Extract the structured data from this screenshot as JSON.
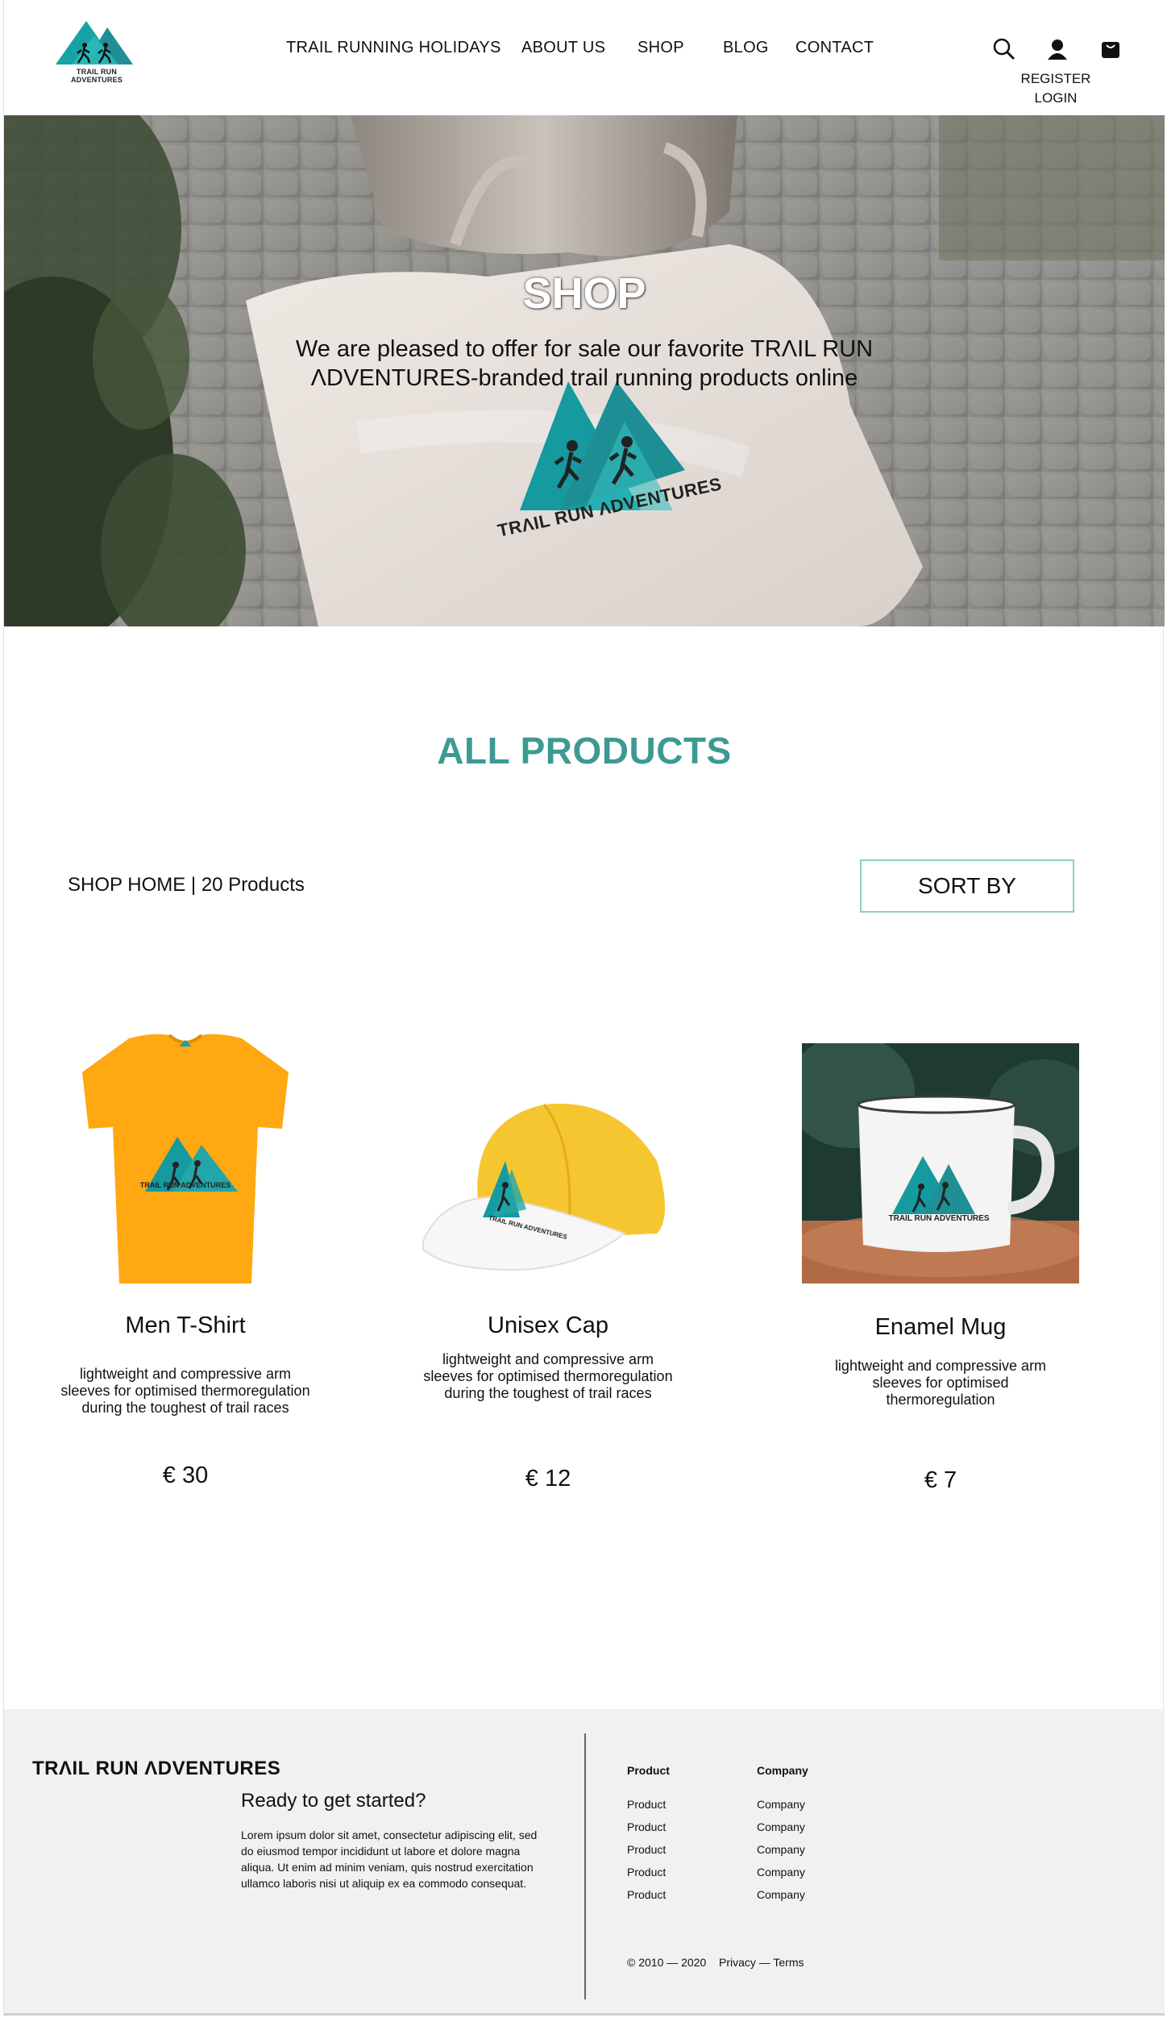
{
  "header": {
    "brand": "TRAIL RUN ADVENTURES",
    "nav": [
      {
        "label": "TRAIL RUNNING HOLIDAYS"
      },
      {
        "label": "ABOUT US"
      },
      {
        "label": "SHOP"
      },
      {
        "label": "BLOG"
      },
      {
        "label": "CONTACT"
      }
    ],
    "register_label": "REGISTER",
    "login_label": "LOGIN",
    "icons": [
      "search-icon",
      "user-icon",
      "bag-icon"
    ]
  },
  "hero": {
    "title": "SHOP",
    "subtitle": "We are pleased to offer for sale our favorite TRΛIL RUN ΛDVENTURES-branded trail running products online",
    "bag_logo_text": "TRΛIL RUN ΛDVENTURES"
  },
  "main": {
    "section_title": "ALL PRODUCTS",
    "breadcrumb": "SHOP HOME | 20 Products",
    "sort_label": "SORT BY",
    "products": [
      {
        "name": "Men T-Shirt",
        "description": "lightweight and compressive arm sleeves for optimised thermoregulation during the toughest of trail races",
        "price": "€ 30",
        "logo_text": "TRAIL RUN ADVENTURES"
      },
      {
        "name": "Unisex Cap",
        "description": "lightweight and compressive arm sleeves for optimised thermoregulation during the toughest of trail races",
        "price": "€ 12",
        "logo_text": "TRAIL RUN ADVENTURES"
      },
      {
        "name": "Enamel Mug",
        "description": "lightweight and compressive arm sleeves for optimised thermoregulation",
        "price": "€ 7",
        "logo_text": "TRAIL RUN ADVENTURES"
      }
    ]
  },
  "footer": {
    "brand": "TRΛIL RUN ΛDVENTURES",
    "cta": "Ready to get started?",
    "lorem": "Lorem ipsum dolor sit amet, consectetur adipiscing elit, sed do eiusmod tempor incididunt ut labore et dolore magna aliqua. Ut enim ad minim veniam, quis nostrud exercitation ullamco laboris nisi ut aliquip ex ea commodo consequat.",
    "product_col": {
      "heading": "Product",
      "links": [
        "Product",
        "Product",
        "Product",
        "Product",
        "Product"
      ]
    },
    "company_col": {
      "heading": "Company",
      "links": [
        "Company",
        "Company",
        "Company",
        "Company",
        "Company"
      ]
    },
    "copyright": "© 2010 — 2020",
    "legal": "Privacy — Terms"
  },
  "colors": {
    "accent": "#3d9a92",
    "logo_teal": "#1fa4a8",
    "shirt": "#ffa812",
    "cap": "#f6c630",
    "footer_bg": "#f1f1f1"
  }
}
